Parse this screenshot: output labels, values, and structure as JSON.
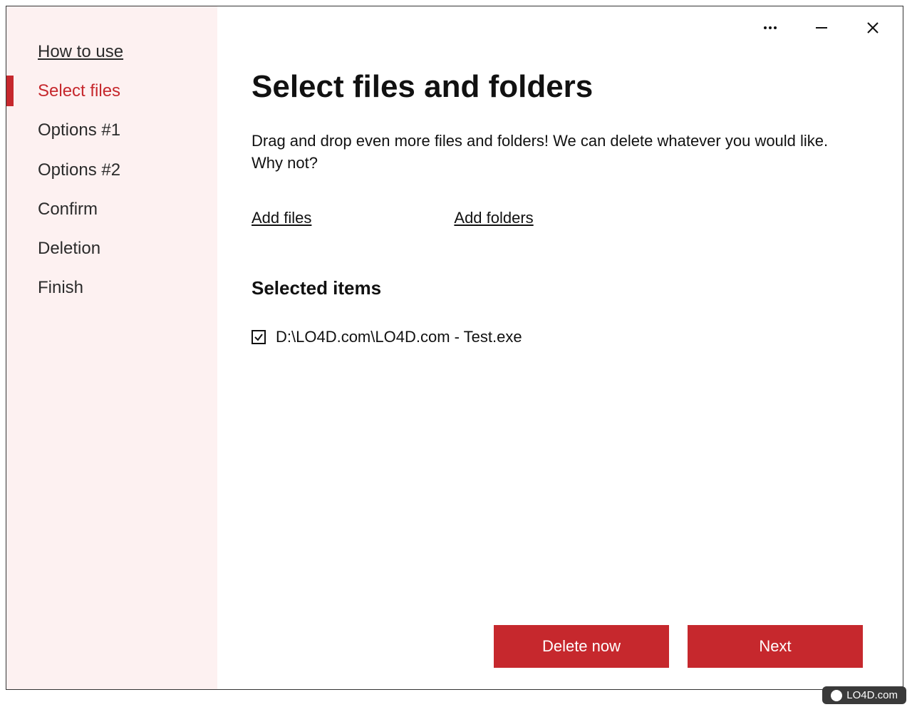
{
  "sidebar": {
    "items": [
      {
        "label": "How to use",
        "active": false,
        "class": "howto"
      },
      {
        "label": "Select files",
        "active": true
      },
      {
        "label": "Options #1",
        "active": false
      },
      {
        "label": "Options #2",
        "active": false
      },
      {
        "label": "Confirm",
        "active": false
      },
      {
        "label": "Deletion",
        "active": false
      },
      {
        "label": "Finish",
        "active": false
      }
    ]
  },
  "titlebar": {
    "menu_icon": "more-icon",
    "minimize_icon": "minimize-icon",
    "close_icon": "close-icon"
  },
  "main": {
    "title": "Select files and folders",
    "description": "Drag and drop even more files and folders! We can delete whatever you would like. Why not?",
    "add_files_label": "Add files",
    "add_folders_label": "Add folders",
    "selected_heading": "Selected items",
    "selected_items": [
      {
        "checked": true,
        "path": "D:\\LO4D.com\\LO4D.com - Test.exe"
      }
    ]
  },
  "footer": {
    "delete_now_label": "Delete now",
    "next_label": "Next"
  },
  "watermark": {
    "text": "LO4D.com"
  }
}
